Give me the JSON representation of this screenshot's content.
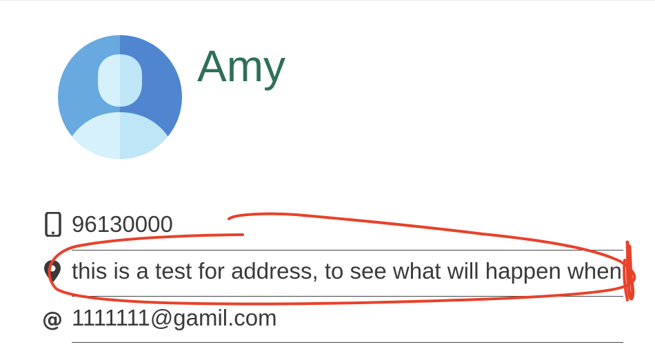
{
  "contact": {
    "name": "Amy",
    "phone": "96130000",
    "address": "this is a test for address, to see what will happen when t",
    "email": "1111111@gamil.com"
  },
  "icons": {
    "avatar": "user-avatar-icon",
    "phone": "mobile-phone-icon",
    "address": "map-pin-icon",
    "email": "at-sign-icon"
  },
  "colors": {
    "name_text": "#2f6f5a",
    "body_text": "#3a3a3a",
    "annotation": "#e8412a",
    "avatar_dark": "#4f86cf",
    "avatar_light": "#68a9e0"
  }
}
